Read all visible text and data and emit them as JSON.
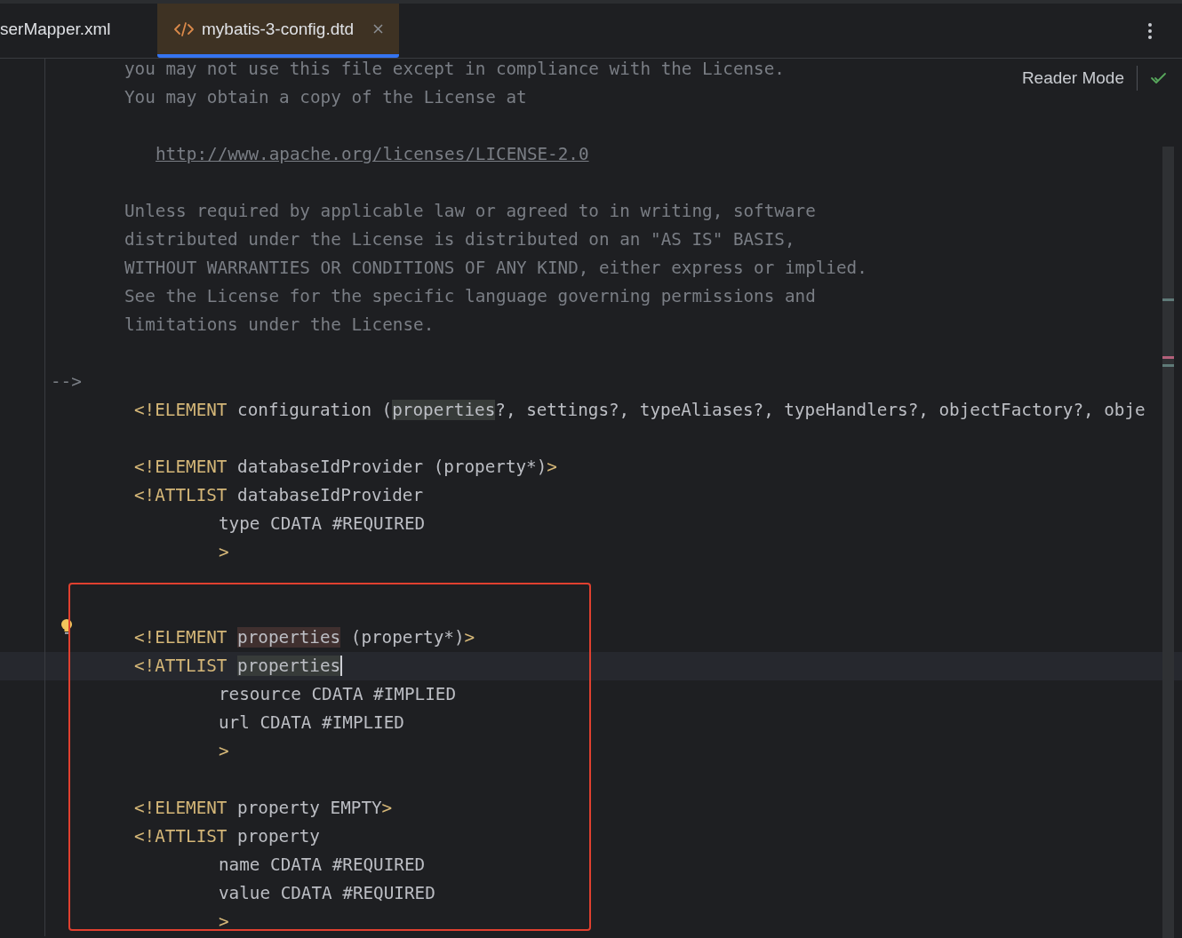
{
  "tabs": [
    {
      "label": "serMapper.xml",
      "selected": false,
      "kind": "xml"
    },
    {
      "label": "mybatis-3-config.dtd",
      "selected": true,
      "kind": "dtd",
      "closable": true
    }
  ],
  "reader_mode": {
    "label": "Reader Mode"
  },
  "code": {
    "lines": [
      {
        "kind": "comment",
        "current": false,
        "bulb": false,
        "tokens": [
          {
            "kind": "comment",
            "text": "you may not use this file except in compliance with the License."
          }
        ]
      },
      {
        "kind": "comment",
        "current": false,
        "bulb": false,
        "tokens": [
          {
            "kind": "comment",
            "text": "You may obtain a copy of the License at"
          }
        ]
      },
      {
        "kind": "blank",
        "current": false,
        "bulb": false
      },
      {
        "kind": "url",
        "current": false,
        "bulb": false,
        "tokens": [
          {
            "kind": "link",
            "text": "http://www.apache.org/licenses/LICENSE-2.0"
          }
        ]
      },
      {
        "kind": "blank",
        "current": false,
        "bulb": false
      },
      {
        "kind": "comment",
        "current": false,
        "bulb": false,
        "tokens": [
          {
            "kind": "comment",
            "text": "Unless required by applicable law or agreed to in writing, software"
          }
        ]
      },
      {
        "kind": "comment",
        "current": false,
        "bulb": false,
        "tokens": [
          {
            "kind": "comment",
            "text": "distributed under the License is distributed on an \"AS IS\" BASIS,"
          }
        ]
      },
      {
        "kind": "comment",
        "current": false,
        "bulb": false,
        "tokens": [
          {
            "kind": "comment",
            "text": "WITHOUT WARRANTIES OR CONDITIONS OF ANY KIND, either express or implied."
          }
        ]
      },
      {
        "kind": "comment",
        "current": false,
        "bulb": false,
        "tokens": [
          {
            "kind": "comment",
            "text": "See the License for the specific language governing permissions and"
          }
        ]
      },
      {
        "kind": "comment",
        "current": false,
        "bulb": false,
        "tokens": [
          {
            "kind": "comment",
            "text": "limitations under the License."
          }
        ]
      },
      {
        "kind": "blank",
        "current": false,
        "bulb": false
      },
      {
        "kind": "end",
        "current": false,
        "bulb": false,
        "tokens": [
          {
            "kind": "comment",
            "text": "-->"
          }
        ]
      },
      {
        "kind": "decl",
        "current": false,
        "bulb": false,
        "tokens": [
          {
            "kind": "tag",
            "text": "<!ELEMENT"
          },
          {
            "kind": "text",
            "text": " configuration ("
          },
          {
            "kind": "read",
            "text": "properties"
          },
          {
            "kind": "text",
            "text": "?, settings?, typeAliases?, typeHandlers?, objectFactory?, obje"
          }
        ]
      },
      {
        "kind": "blank",
        "current": false,
        "bulb": false
      },
      {
        "kind": "decl",
        "current": false,
        "bulb": false,
        "tokens": [
          {
            "kind": "tag",
            "text": "<!ELEMENT"
          },
          {
            "kind": "text",
            "text": " databaseIdProvider (property*)"
          },
          {
            "kind": "tag",
            "text": ">"
          }
        ]
      },
      {
        "kind": "decl",
        "current": false,
        "bulb": false,
        "tokens": [
          {
            "kind": "tag",
            "text": "<!ATTLIST"
          },
          {
            "kind": "text",
            "text": " databaseIdProvider"
          }
        ]
      },
      {
        "kind": "attr",
        "current": false,
        "bulb": false,
        "tokens": [
          {
            "kind": "text",
            "text": "type CDATA #REQUIRED"
          }
        ]
      },
      {
        "kind": "attr",
        "current": false,
        "bulb": false,
        "tokens": [
          {
            "kind": "tag",
            "text": ">"
          }
        ]
      },
      {
        "kind": "blank",
        "current": false,
        "bulb": false
      }
    ],
    "boxed_lines": [
      {
        "kind": "blank",
        "current": false,
        "bulb": false
      },
      {
        "kind": "decl",
        "current": false,
        "bulb": true,
        "tokens": [
          {
            "kind": "tag",
            "text": "<!ELEMENT "
          },
          {
            "kind": "write",
            "text": "properties"
          },
          {
            "kind": "text",
            "text": " (property*)"
          },
          {
            "kind": "tag",
            "text": ">"
          }
        ]
      },
      {
        "kind": "decl",
        "current": true,
        "bulb": false,
        "tokens": [
          {
            "kind": "tag",
            "text": "<!ATTLIST "
          },
          {
            "kind": "read",
            "text": "properties"
          }
        ]
      },
      {
        "kind": "attr",
        "current": false,
        "bulb": false,
        "tokens": [
          {
            "kind": "text",
            "text": "resource CDATA #IMPLIED"
          }
        ]
      },
      {
        "kind": "attr",
        "current": false,
        "bulb": false,
        "tokens": [
          {
            "kind": "text",
            "text": "url CDATA #IMPLIED"
          }
        ]
      },
      {
        "kind": "attr",
        "current": false,
        "bulb": false,
        "tokens": [
          {
            "kind": "tag",
            "text": ">"
          }
        ]
      },
      {
        "kind": "blank",
        "current": false,
        "bulb": false
      },
      {
        "kind": "decl",
        "current": false,
        "bulb": false,
        "tokens": [
          {
            "kind": "tag",
            "text": "<!ELEMENT"
          },
          {
            "kind": "text",
            "text": " property EMPTY"
          },
          {
            "kind": "tag",
            "text": ">"
          }
        ]
      },
      {
        "kind": "decl",
        "current": false,
        "bulb": false,
        "tokens": [
          {
            "kind": "tag",
            "text": "<!ATTLIST"
          },
          {
            "kind": "text",
            "text": " property"
          }
        ]
      },
      {
        "kind": "attr",
        "current": false,
        "bulb": false,
        "tokens": [
          {
            "kind": "text",
            "text": "name CDATA #REQUIRED"
          }
        ]
      },
      {
        "kind": "attr",
        "current": false,
        "bulb": false,
        "tokens": [
          {
            "kind": "text",
            "text": "value CDATA #REQUIRED"
          }
        ]
      },
      {
        "kind": "attr",
        "current": false,
        "bulb": false,
        "tokens": [
          {
            "kind": "tag",
            "text": ">"
          }
        ]
      }
    ]
  }
}
